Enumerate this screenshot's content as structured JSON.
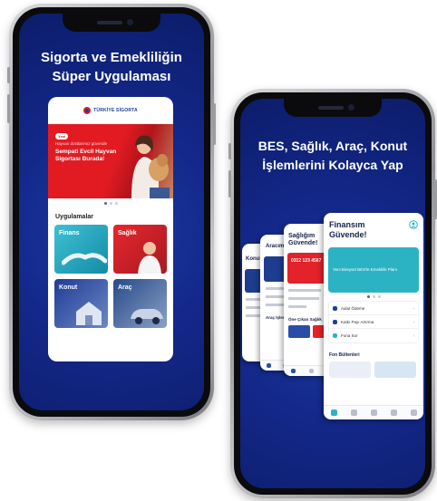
{
  "phone1": {
    "headline_line1": "Sigorta ve Emekliliğin",
    "headline_line2": "Süper Uygulaması",
    "brand": "TÜRKİYE SİGORTA",
    "banner": {
      "pill": "Yeni",
      "subtitle": "Hayvan dostlarımız güvende",
      "title": "Sempati Evcil Hayvan Sigortası Burada!"
    },
    "apps_title": "Uygulamalar",
    "tiles": [
      "Finans",
      "Sağlık",
      "Konut",
      "Araç"
    ]
  },
  "phone2": {
    "headline_line1": "BES, Sağlık, Araç, Konut",
    "headline_line2": "İşlemlerini Kolayca Yap",
    "cards": {
      "konut": {
        "title": "Konut"
      },
      "arac": {
        "title": "Aracım Güvende!",
        "section": "Araç İşlemleri"
      },
      "saglik": {
        "title_line1": "Sağlığım",
        "title_line2": "Güvende!",
        "phone": "0312 123 4567",
        "section": "Öne Çıkan Sağlık"
      },
      "finans": {
        "title_line1": "Finansım",
        "title_line2": "Güvende!",
        "banner_text": "Yeni Bireysel BES'le Emeklilik Planı",
        "menu": [
          "Aidat Ödeme",
          "Katkı Payı Artırma",
          "Fona Sor"
        ],
        "section": "Fon Bültenleri"
      }
    }
  },
  "colors": {
    "background_blue": "#13288a",
    "brand_red": "#e21b23",
    "brand_blue": "#1b3e9c",
    "teal": "#2bb3c4"
  }
}
